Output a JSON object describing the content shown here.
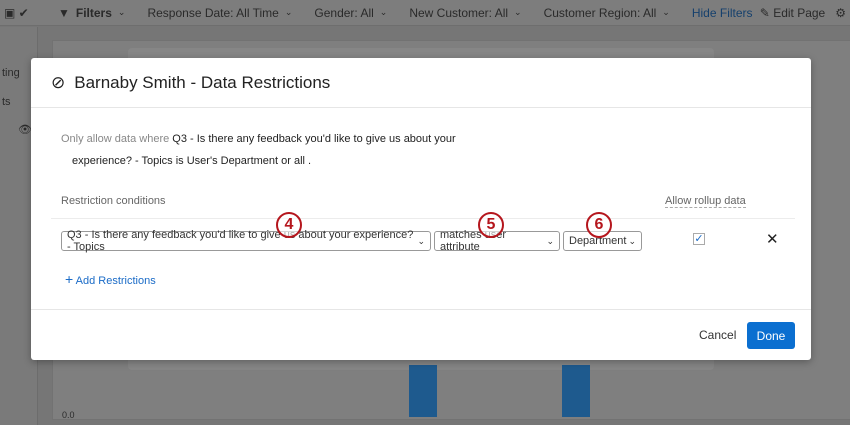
{
  "topbar": {
    "filters": "Filters",
    "response_date": "Response Date: All Time",
    "gender": "Gender: All",
    "new_customer": "New Customer: All",
    "customer_region": "Customer Region: All",
    "hide_filters": "Hide Filters",
    "edit_page": "Edit Page"
  },
  "sidebar": {
    "item1": "ting",
    "item2": "ts"
  },
  "chart": {
    "y_tick": "0.0"
  },
  "modal": {
    "title": "Barnaby Smith - Data Restrictions",
    "desc_prefix": "Only allow data where",
    "desc_line1": "Q3 - Is there any feedback you'd like to give us about your",
    "desc_line2": "experience? - Topics is User's Department or all .",
    "restriction_header": "Restriction conditions",
    "rollup_header": "Allow rollup data",
    "condition": {
      "field": "Q3 - Is there any feedback you'd like to give us about your experience? - Topics",
      "operator": "matches user attribute",
      "attribute": "Department",
      "rollup_checked": true
    },
    "add_restrictions": "Add Restrictions",
    "cancel": "Cancel",
    "done": "Done"
  },
  "annotations": [
    "4",
    "5",
    "6"
  ],
  "colors": {
    "accent": "#0b6fd0",
    "annotation": "#b5161d"
  }
}
